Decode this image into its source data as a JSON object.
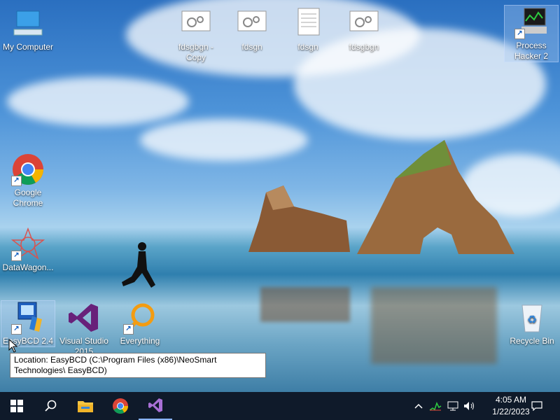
{
  "desktop": {
    "icons": {
      "my_computer": "My Computer",
      "fdsgbgn_copy": "fdsgbgn - Copy",
      "fdsgn_1": "fdsgn",
      "fdsgn_2": "fdsgn",
      "fdsgbgn": "fdsgbgn",
      "process_hacker": "Process Hacker 2",
      "chrome": "Google Chrome",
      "datawagon": "DataWagon...",
      "easybcd": "EasyBCD 2.4",
      "visual_studio": "Visual Studio 2015",
      "everything": "Everything",
      "recycle_bin": "Recycle Bin"
    },
    "tooltip": "Location: EasyBCD (C:\\Program Files (x86)\\NeoSmart Technologies\\ EasyBCD)"
  },
  "taskbar": {
    "time": "4:05 AM",
    "date": "1/22/2023",
    "icons": [
      "windows-start-icon",
      "search-icon",
      "file-explorer-icon",
      "chrome-icon",
      "visual-studio-icon"
    ]
  },
  "colors": {
    "taskbar": "#0f1a2a",
    "accent": "#8ab4f8"
  }
}
